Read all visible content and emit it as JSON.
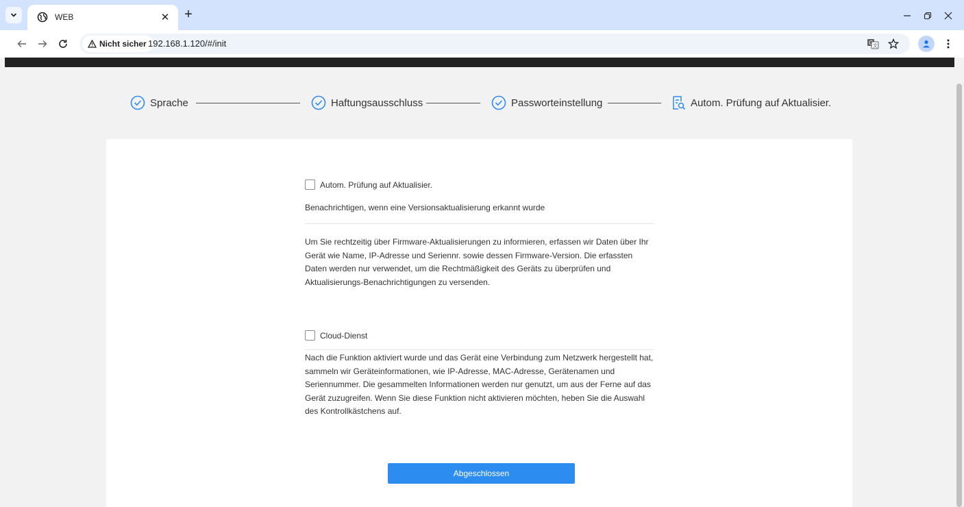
{
  "browser": {
    "tab_title": "WEB",
    "new_tab_symbol": "+",
    "security_label": "Nicht sicher",
    "url": "192.168.1.120/#/init",
    "icons": [
      "tab-search-icon",
      "globe-icon",
      "close-icon",
      "back-icon",
      "forward-icon",
      "reload-icon",
      "warning-icon",
      "translate-icon",
      "star-icon",
      "profile-icon",
      "menu-kebab-icon",
      "minimize-icon",
      "restore-icon",
      "window-close-icon"
    ]
  },
  "steps": [
    {
      "label": "Sprache",
      "status": "done"
    },
    {
      "label": "Haftungsausschluss",
      "status": "done"
    },
    {
      "label": "Passworteinstellung",
      "status": "done"
    },
    {
      "label": "Autom. Prüfung auf Aktualisier.",
      "status": "current"
    }
  ],
  "auto_update": {
    "checkbox_label": "Autom. Prüfung auf Aktualisier.",
    "checked": false,
    "notify_text": "Benachrichtigen, wenn eine Versionsaktualisierung erkannt wurde",
    "description": "Um Sie rechtzeitig über Firmware-Aktualisierungen zu informieren, erfassen wir Daten über Ihr Gerät wie Name, IP-Adresse und Seriennr. sowie dessen Firmware-Version. Die erfassten Daten werden nur verwendet, um die Rechtmäßigkeit des Geräts zu überprüfen und Aktualisierungs-Benachrichtigungen zu versenden."
  },
  "cloud": {
    "checkbox_label": "Cloud-Dienst",
    "checked": false,
    "description": "Nach die Funktion aktiviert wurde und das Gerät eine Verbindung zum Netzwerk hergestellt hat, sammeln wir Geräteinformationen, wie IP-Adresse, MAC-Adresse, Gerätenamen und Seriennummer. Die gesammelten Informationen werden nur genutzt, um aus der Ferne auf das Gerät zuzugreifen. Wenn Sie diese Funktion nicht aktivieren möchten, heben Sie die Auswahl des Kontrollkästchens auf."
  },
  "finish_button": "Abgeschlossen",
  "colors": {
    "accent": "#2d8cf0",
    "page_bg": "#f2f2f2",
    "tabstrip": "#d3e3fd"
  }
}
